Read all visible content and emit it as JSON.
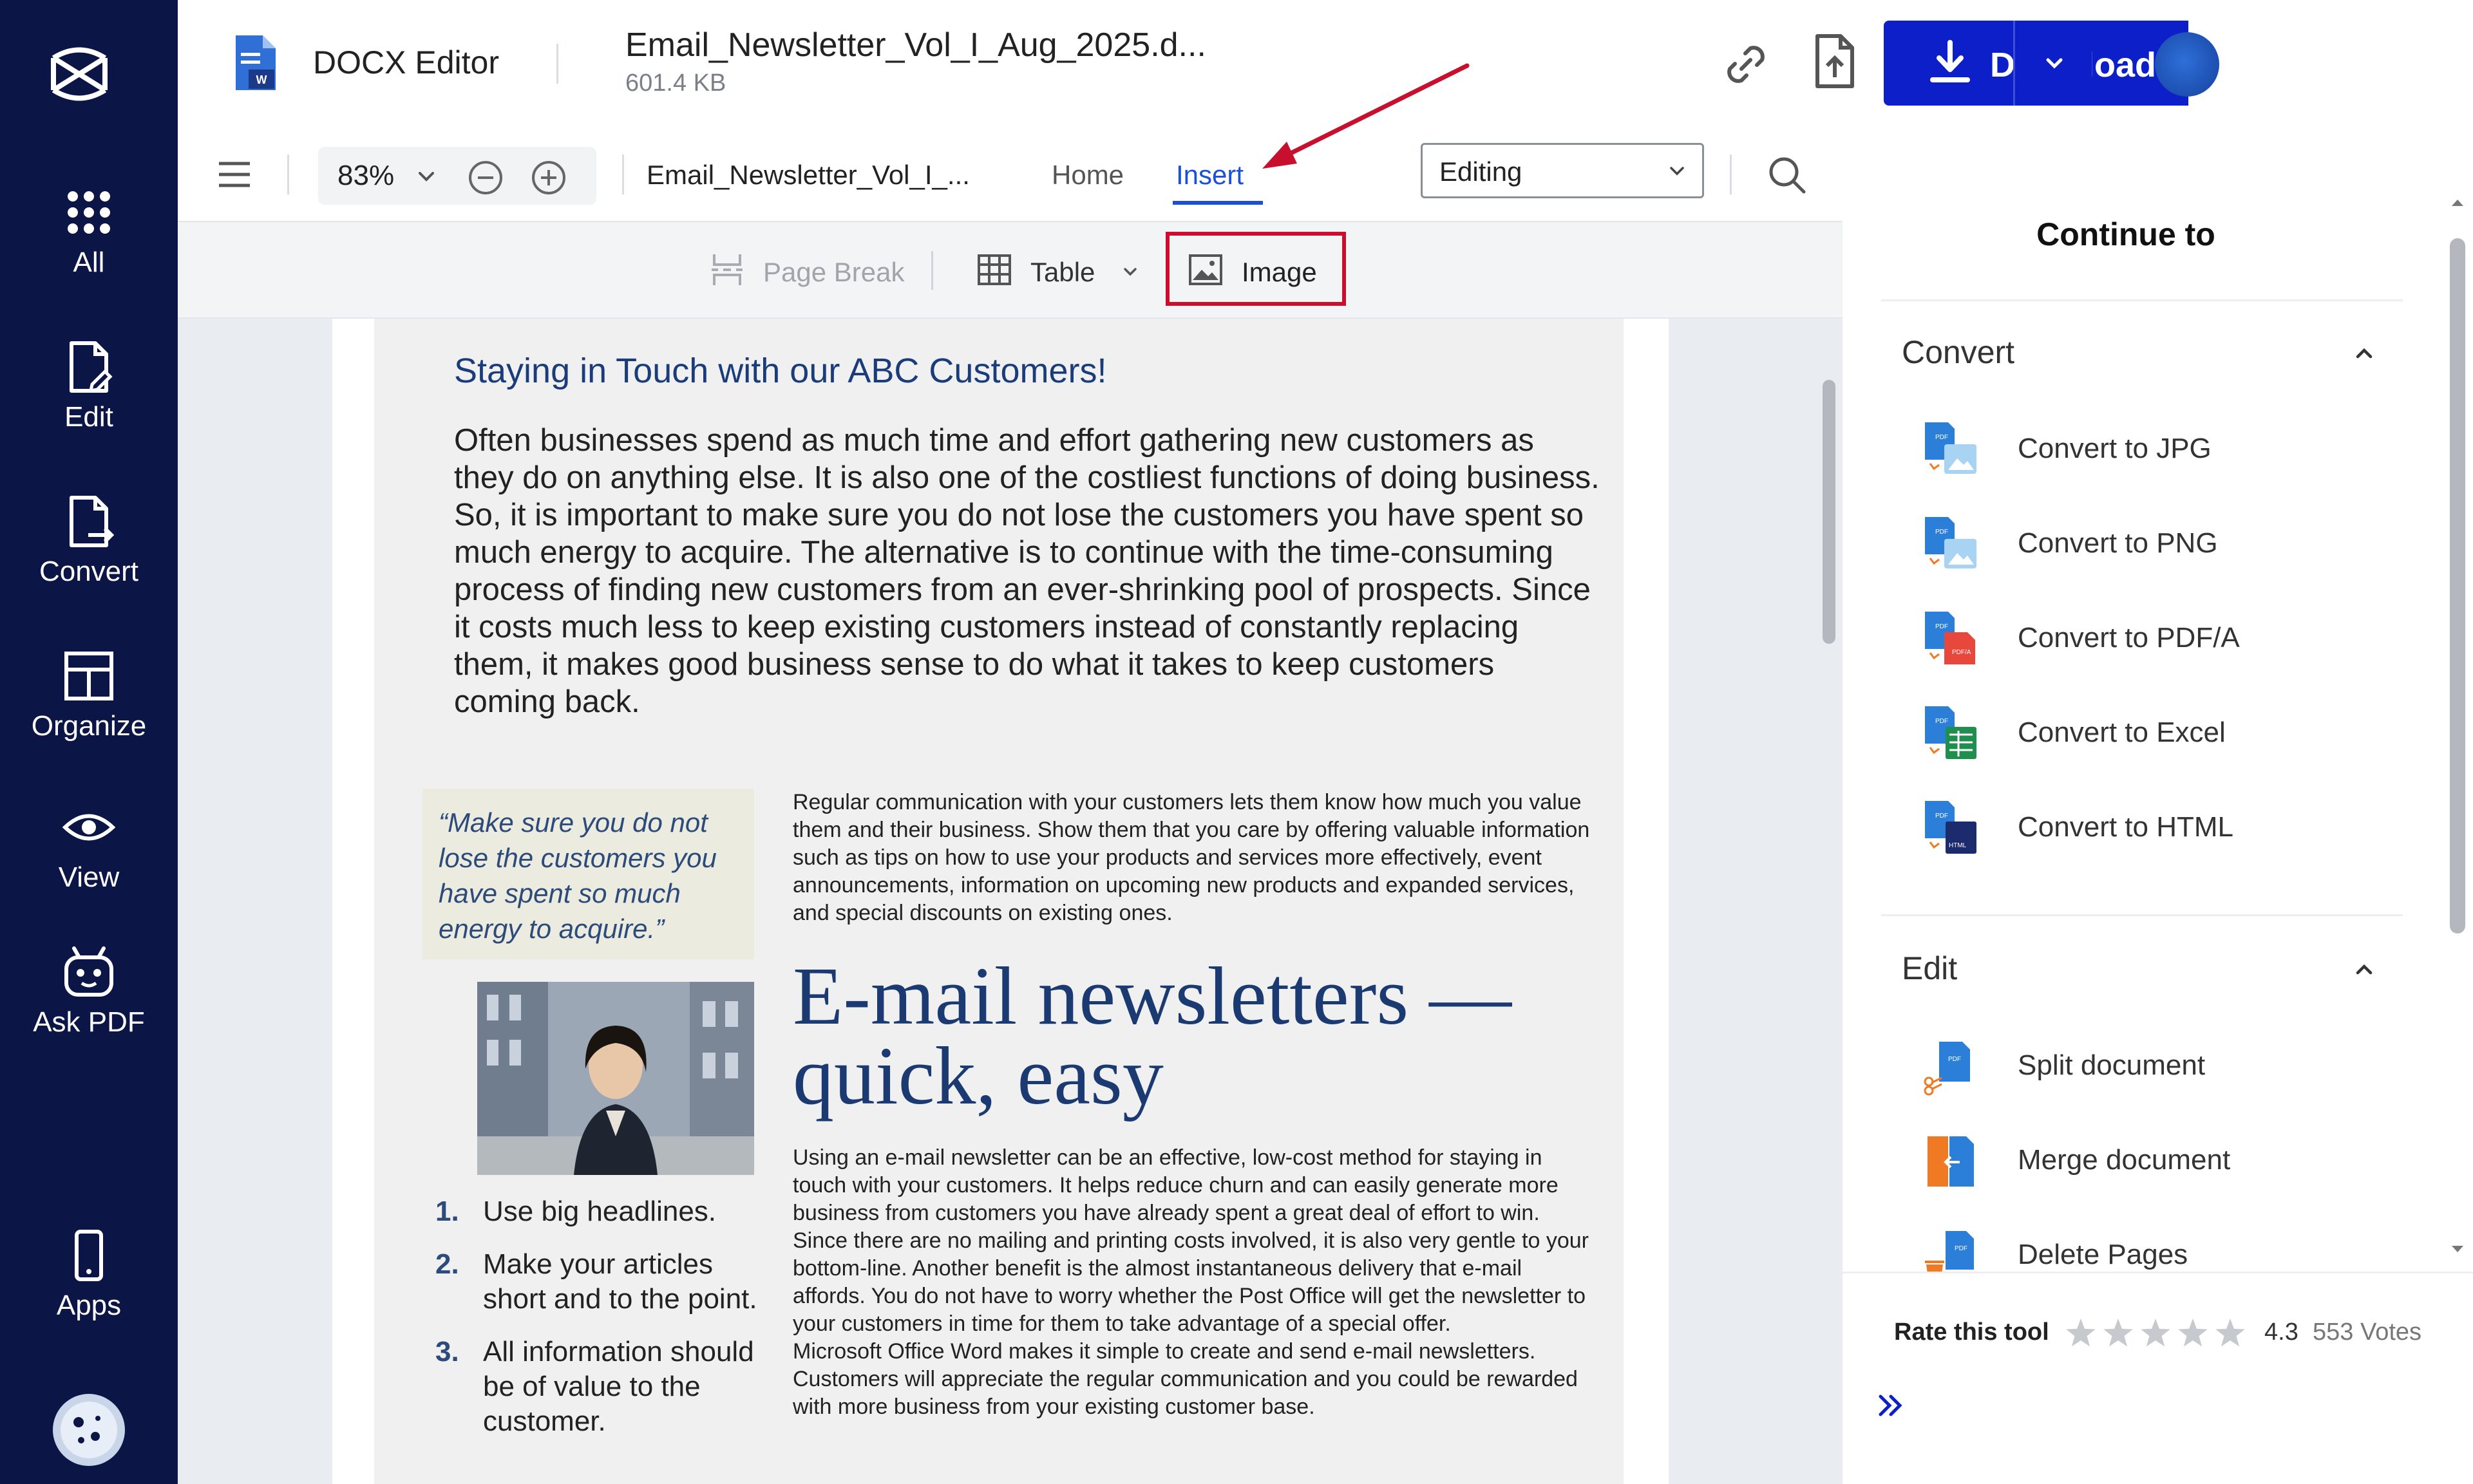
{
  "sidebar": {
    "items": [
      {
        "label": "All",
        "icon": "grid-icon"
      },
      {
        "label": "Edit",
        "icon": "edit-file-icon"
      },
      {
        "label": "Convert",
        "icon": "convert-file-icon"
      },
      {
        "label": "Organize",
        "icon": "layout-icon"
      },
      {
        "label": "View",
        "icon": "eye-icon"
      },
      {
        "label": "Ask PDF",
        "icon": "robot-icon"
      },
      {
        "label": "Apps",
        "icon": "mobile-icon"
      }
    ]
  },
  "header": {
    "app_name": "DOCX Editor",
    "file_name": "Email_Newsletter_Vol_I_Aug_2025.d...",
    "file_size": "601.4 KB",
    "download_label": "Download",
    "brand_color": "#0c1fc8"
  },
  "toolbar": {
    "zoom": "83%",
    "doc_short_name": "Email_Newsletter_Vol_I_...",
    "tabs": [
      {
        "label": "Home",
        "active": false
      },
      {
        "label": "Insert",
        "active": true
      }
    ],
    "mode": "Editing"
  },
  "ribbon": {
    "page_break": "Page Break",
    "table": "Table",
    "image": "Image"
  },
  "document": {
    "title": "Staying in Touch with our ABC Customers!",
    "intro": "Often businesses spend as much time and effort gathering new customers as they do on anything else. It is also one of the costliest functions of doing business. So, it is important to make sure you do not lose the customers you have spent so much energy to acquire. The alternative is to continue with the time-consuming process of finding new customers from an ever-shrinking pool of prospects. Since it costs much less to keep existing customers instead of constantly replacing them, it makes good business sense to do what it takes to keep customers coming back.",
    "quote": "“Make sure you do not lose the customers you have spent so much energy to acquire.”",
    "tips": [
      {
        "num": "1.",
        "text": "Use big headlines."
      },
      {
        "num": "2.",
        "text": "Make your articles short and to the point."
      },
      {
        "num": "3.",
        "text": "All information should be of value to the customer."
      }
    ],
    "para1": "Regular communication with your customers lets them know how much you value them and their business. Show them that you care by offering valuable information such as tips on how to use your products and services more effectively, event announcements, information on upcoming new products and expanded services, and special discounts on existing ones.",
    "big_heading": "E-mail newsletters — quick, easy",
    "para2": "Using an e-mail newsletter can be an effective, low-cost method for staying in touch with your customers. It helps reduce churn and can easily generate more business from customers you have already spent a great deal of effort to win. Since there are no mailing and printing costs involved, it is also very gentle to your bottom-line. Another benefit is the almost instantaneous delivery that e-mail affords. You do not have to worry whether the Post Office will get the newsletter to your customers in time for them to take advantage of a special offer.",
    "para3": "Microsoft Office Word makes it simple to create and send e-mail newsletters. Customers will appreciate the regular communication and you could be rewarded with more business from your existing customer base."
  },
  "right_panel": {
    "title": "Continue to",
    "convert_section": "Convert",
    "convert_items": [
      {
        "label": "Convert to JPG",
        "icon": "pdf-to-jpg-icon"
      },
      {
        "label": "Convert to PNG",
        "icon": "pdf-to-png-icon"
      },
      {
        "label": "Convert to PDF/A",
        "icon": "pdf-to-pdfa-icon"
      },
      {
        "label": "Convert to Excel",
        "icon": "pdf-to-excel-icon"
      },
      {
        "label": "Convert to HTML",
        "icon": "pdf-to-html-icon"
      }
    ],
    "edit_section": "Edit",
    "edit_items": [
      {
        "label": "Split document",
        "icon": "split-icon"
      },
      {
        "label": "Merge document",
        "icon": "merge-icon"
      },
      {
        "label": "Delete Pages",
        "icon": "delete-pages-icon"
      }
    ],
    "rate_label": "Rate this tool",
    "rating": "4.3",
    "votes": "553 Votes",
    "rating_value": 4.3
  }
}
